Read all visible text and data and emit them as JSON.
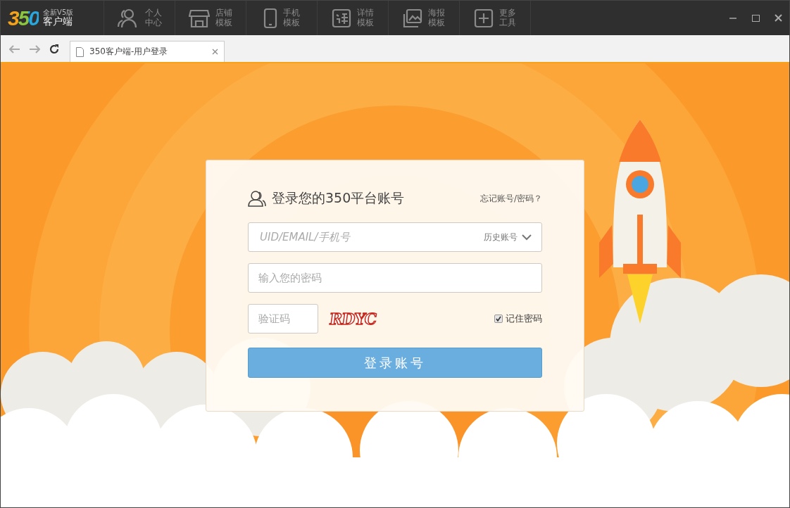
{
  "app": {
    "logo": "350",
    "edition": "全新V5版",
    "name": "客户端"
  },
  "nav": [
    {
      "line1": "个人",
      "line2": "中心"
    },
    {
      "line1": "店铺",
      "line2": "模板"
    },
    {
      "line1": "手机",
      "line2": "模板"
    },
    {
      "line1": "详情",
      "line2": "模板"
    },
    {
      "line1": "海报",
      "line2": "模板"
    },
    {
      "line1": "更多",
      "line2": "工具"
    }
  ],
  "browser": {
    "tab_title": "350客户端-用户登录"
  },
  "login": {
    "title": "登录您的350平台账号",
    "forgot": "忘记账号/密码？",
    "account": {
      "placeholder": "UID/EMAIL/手机号",
      "history": "历史账号"
    },
    "password": {
      "placeholder": "输入您的密码"
    },
    "captcha": {
      "placeholder": "验证码",
      "code": "RDYC"
    },
    "remember": {
      "label": "记住密码",
      "checked": true
    },
    "submit": "登录账号"
  }
}
